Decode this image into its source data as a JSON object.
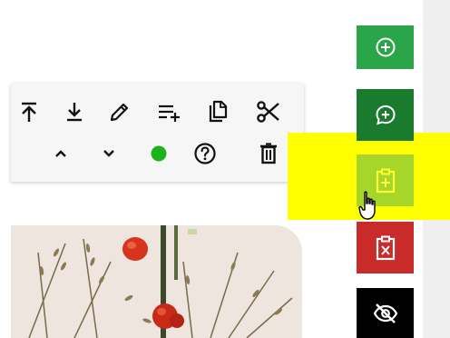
{
  "toolbar": {
    "row1": [
      {
        "name": "move-to-top-icon"
      },
      {
        "name": "download-icon"
      },
      {
        "name": "edit-pencil-icon"
      },
      {
        "name": "add-to-playlist-icon"
      },
      {
        "name": "copy-icon"
      },
      {
        "name": "cut-scissors-icon"
      }
    ],
    "row2": [
      {
        "name": "chevron-up-icon"
      },
      {
        "name": "chevron-down-icon"
      },
      {
        "name": "status-dot-icon",
        "color": "#1bb21b"
      },
      {
        "name": "help-icon"
      },
      {
        "name": "trash-icon"
      }
    ]
  },
  "side_buttons": [
    {
      "name": "add-circle-icon",
      "color": "#2aa54a"
    },
    {
      "name": "add-comment-icon",
      "color": "#1a7a2e"
    },
    {
      "name": "clipboard-add-icon",
      "color": "#a6d62a"
    },
    {
      "name": "clipboard-remove-icon",
      "color": "#c92a2a"
    },
    {
      "name": "eye-off-icon",
      "color": "#000000"
    }
  ],
  "colors": {
    "highlight": "#ffff00",
    "toolbar_bg": "#f6f6f6"
  }
}
